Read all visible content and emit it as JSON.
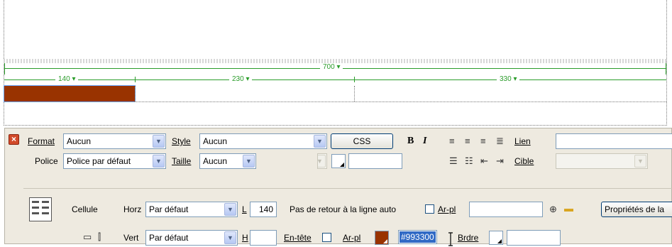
{
  "table_widths": {
    "total": "700 ▾",
    "col1": "140 ▾",
    "col2": "230 ▾",
    "col3": "330 ▾"
  },
  "colors": {
    "cell_bg": "#993300",
    "guide": "#2a9c2a",
    "selection": "#316ac5"
  },
  "row1": {
    "format_label": "Format",
    "format_value": "Aucun",
    "style_label": "Style",
    "style_value": "Aucun",
    "css_button": "CSS",
    "bold": "B",
    "italic": "I",
    "link_label": "Lien"
  },
  "row2": {
    "font_label": "Police",
    "font_value": "Police par défaut",
    "size_label": "Taille",
    "size_value": "Aucun",
    "target_label": "Cible"
  },
  "cell": {
    "cell_label": "Cellule",
    "horz_label": "Horz",
    "horz_value": "Par défaut",
    "w_label": "L",
    "w_value": "140",
    "nowrap_label": "Pas de retour à la ligne auto",
    "bgimg_label": "Ar-pl",
    "page_props_button": "Propriétés de la",
    "vert_label": "Vert",
    "vert_value": "Par défaut",
    "h_label": "H",
    "header_label": "En-tête",
    "bgcolor_label": "Ar-pl",
    "bgcolor_value": "#993300",
    "border_label": "Brdre"
  }
}
